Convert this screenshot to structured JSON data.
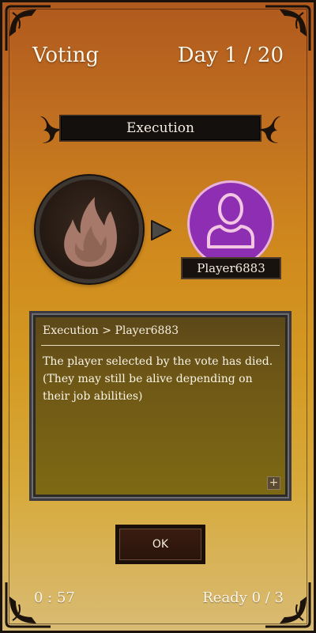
{
  "header": {
    "phase": "Voting",
    "day": "Day 1 / 20"
  },
  "banner": {
    "label": "Execution"
  },
  "action": {
    "icon": "fire-icon",
    "arrow_icon": "play-arrow-icon"
  },
  "target": {
    "avatar_icon": "person-icon",
    "name": "Player6883",
    "avatar_color": "#8e2fb3"
  },
  "panel": {
    "title": "Execution > Player6883",
    "body": "The player selected by the vote has died. (They may still be alive depending on their job abilities)",
    "expand_label": "+"
  },
  "ok_button": {
    "label": "OK"
  },
  "footer": {
    "timer": "0 : 57",
    "ready": "Ready 0 / 3"
  }
}
